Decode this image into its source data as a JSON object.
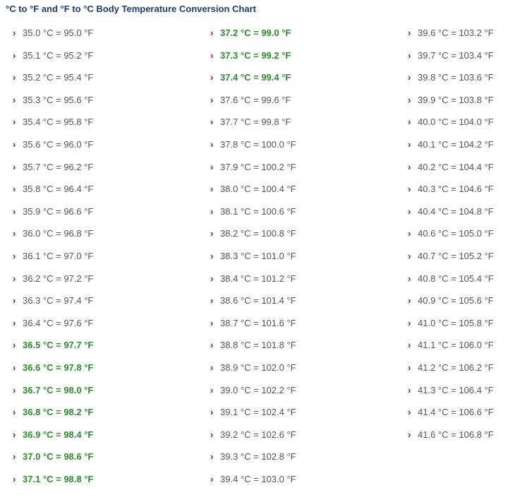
{
  "title": "°C to °F and °F to °C Body Temperature Conversion Chart",
  "bullet_icon": "chevron-right-icon",
  "colors": {
    "title": "#1f3b6e",
    "normal_text": "#555555",
    "highlight_text": "#2e8b2e",
    "bullet": "#8b1a2a"
  },
  "columns": [
    [
      {
        "text": "35.0 °C = 95.0 °F",
        "highlight": false
      },
      {
        "text": "35.1 °C = 95.2 °F",
        "highlight": false
      },
      {
        "text": "35.2 °C = 95.4 °F",
        "highlight": false
      },
      {
        "text": "35.3 °C = 95.6 °F",
        "highlight": false
      },
      {
        "text": "35.4 °C = 95.8 °F",
        "highlight": false
      },
      {
        "text": "35.6 °C = 96.0 °F",
        "highlight": false
      },
      {
        "text": "35.7 °C = 96.2 °F",
        "highlight": false
      },
      {
        "text": "35.8 °C = 96.4 °F",
        "highlight": false
      },
      {
        "text": "35.9 °C = 96.6 °F",
        "highlight": false
      },
      {
        "text": "36.0 °C = 96.8 °F",
        "highlight": false
      },
      {
        "text": "36.1 °C = 97.0 °F",
        "highlight": false
      },
      {
        "text": "36.2 °C = 97.2 °F",
        "highlight": false
      },
      {
        "text": "36.3 °C = 97.4 °F",
        "highlight": false
      },
      {
        "text": "36.4 °C = 97.6 °F",
        "highlight": false
      },
      {
        "text": "36.5 °C = 97.7 °F",
        "highlight": true
      },
      {
        "text": "36.6 °C = 97.8 °F",
        "highlight": true
      },
      {
        "text": "36.7 °C = 98.0 °F",
        "highlight": true
      },
      {
        "text": "36.8 °C = 98.2 °F",
        "highlight": true
      },
      {
        "text": "36.9 °C = 98.4 °F",
        "highlight": true
      },
      {
        "text": "37.0 °C = 98.6 °F",
        "highlight": true
      },
      {
        "text": "37.1 °C = 98.8 °F",
        "highlight": true
      }
    ],
    [
      {
        "text": "37.2 °C = 99.0 °F",
        "highlight": true
      },
      {
        "text": "37.3 °C = 99.2 °F",
        "highlight": true
      },
      {
        "text": "37.4 °C = 99.4 °F",
        "highlight": true
      },
      {
        "text": "37.6 °C = 99.6 °F",
        "highlight": false
      },
      {
        "text": "37.7 °C = 99.8 °F",
        "highlight": false
      },
      {
        "text": "37.8 °C = 100.0 °F",
        "highlight": false
      },
      {
        "text": "37.9 °C = 100.2 °F",
        "highlight": false
      },
      {
        "text": "38.0 °C = 100.4 °F",
        "highlight": false
      },
      {
        "text": "38.1 °C = 100.6 °F",
        "highlight": false
      },
      {
        "text": "38.2 °C = 100.8 °F",
        "highlight": false
      },
      {
        "text": "38.3 °C = 101.0 °F",
        "highlight": false
      },
      {
        "text": "38.4 °C = 101.2 °F",
        "highlight": false
      },
      {
        "text": "38.6 °C = 101.4 °F",
        "highlight": false
      },
      {
        "text": "38.7 °C = 101.6 °F",
        "highlight": false
      },
      {
        "text": "38.8 °C = 101.8 °F",
        "highlight": false
      },
      {
        "text": "38.9 °C = 102.0 °F",
        "highlight": false
      },
      {
        "text": "39.0 °C = 102.2 °F",
        "highlight": false
      },
      {
        "text": "39.1 °C = 102.4 °F",
        "highlight": false
      },
      {
        "text": "39.2 °C = 102.6 °F",
        "highlight": false
      },
      {
        "text": "39.3 °C = 102.8 °F",
        "highlight": false
      },
      {
        "text": "39.4 °C = 103.0 °F",
        "highlight": false
      }
    ],
    [
      {
        "text": "39.6 °C = 103.2 °F",
        "highlight": false
      },
      {
        "text": "39.7 °C = 103.4 °F",
        "highlight": false
      },
      {
        "text": "39.8 °C = 103.6 °F",
        "highlight": false
      },
      {
        "text": "39.9 °C = 103.8 °F",
        "highlight": false
      },
      {
        "text": "40.0 °C = 104.0 °F",
        "highlight": false
      },
      {
        "text": "40.1 °C = 104.2 °F",
        "highlight": false
      },
      {
        "text": "40.2 °C = 104.4 °F",
        "highlight": false
      },
      {
        "text": "40.3 °C = 104.6 °F",
        "highlight": false
      },
      {
        "text": "40.4 °C = 104.8 °F",
        "highlight": false
      },
      {
        "text": "40.6 °C = 105.0 °F",
        "highlight": false
      },
      {
        "text": "40.7 °C = 105.2 °F",
        "highlight": false
      },
      {
        "text": "40.8 °C = 105.4 °F",
        "highlight": false
      },
      {
        "text": "40.9 °C = 105.6 °F",
        "highlight": false
      },
      {
        "text": "41.0 °C = 105.8 °F",
        "highlight": false
      },
      {
        "text": "41.1 °C = 106.0 °F",
        "highlight": false
      },
      {
        "text": "41.2 °C = 106.2 °F",
        "highlight": false
      },
      {
        "text": "41.3 °C = 106.4 °F",
        "highlight": false
      },
      {
        "text": "41.4 °C = 106.6 °F",
        "highlight": false
      },
      {
        "text": "41.6 °C = 106.8 °F",
        "highlight": false
      }
    ]
  ]
}
